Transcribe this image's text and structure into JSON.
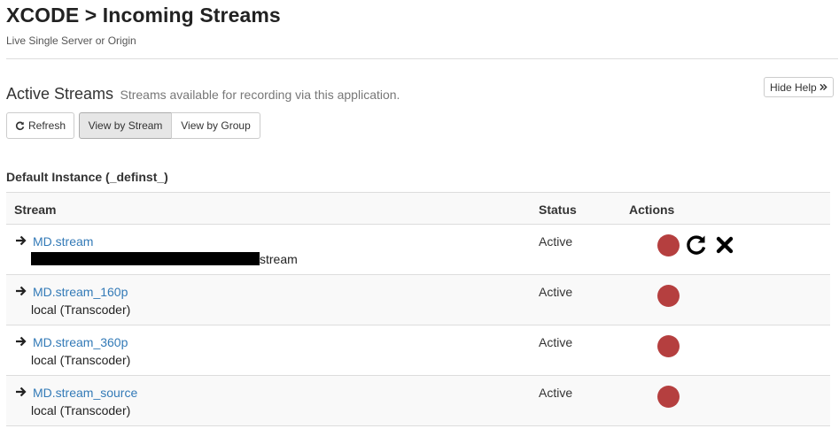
{
  "page": {
    "title": "XCODE > Incoming Streams",
    "subtitle": "Live Single Server or Origin"
  },
  "section": {
    "title": "Active Streams",
    "description": "Streams available for recording via this application."
  },
  "help_button": {
    "label": "Hide Help",
    "icon": "double-chevron-right-icon"
  },
  "toolbar": {
    "refresh_label": "Refresh",
    "view_by_stream_label": "View by Stream",
    "view_by_group_label": "View by Group",
    "active_view": "View by Stream"
  },
  "instance": {
    "label": "Default Instance (_definst_)"
  },
  "table": {
    "columns": {
      "stream": "Stream",
      "status": "Status",
      "actions": "Actions"
    },
    "rows": [
      {
        "name": "MD.stream",
        "source": "stream",
        "source_redacted": true,
        "status": "Active",
        "actions": [
          "record-icon",
          "reset-icon",
          "close-icon"
        ]
      },
      {
        "name": "MD.stream_160p",
        "source": "local (Transcoder)",
        "status": "Active",
        "actions": [
          "record-icon"
        ]
      },
      {
        "name": "MD.stream_360p",
        "source": "local (Transcoder)",
        "status": "Active",
        "actions": [
          "record-icon"
        ]
      },
      {
        "name": "MD.stream_source",
        "source": "local (Transcoder)",
        "status": "Active",
        "actions": [
          "record-icon"
        ]
      }
    ]
  },
  "colors": {
    "link": "#337ab7",
    "record": "#b53f3f",
    "active_button_bg": "#e6e6e6",
    "row_alt_bg": "#f9f9f9",
    "border": "#dddddd"
  }
}
